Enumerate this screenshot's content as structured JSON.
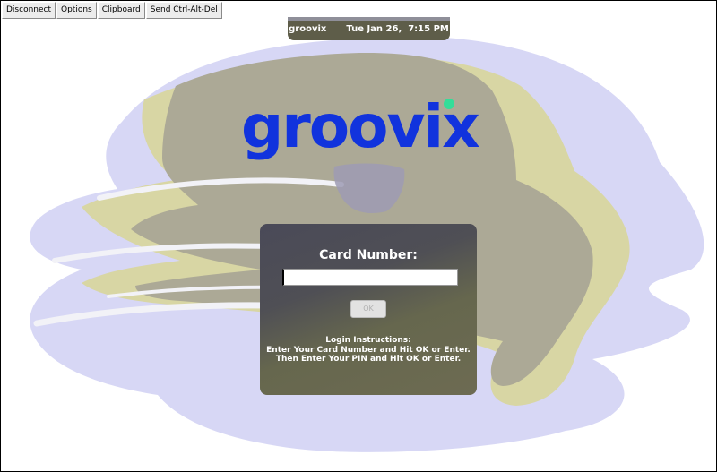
{
  "toolbar": {
    "items": [
      {
        "label": "Disconnect"
      },
      {
        "label": "Options"
      },
      {
        "label": "Clipboard"
      },
      {
        "label": "Send Ctrl-Alt-Del"
      }
    ]
  },
  "clock_bar": {
    "name": "groovix",
    "datetime": "Tue Jan 26,  7:15 PM"
  },
  "logo": {
    "text": "groovix",
    "color": "#1133dd",
    "dot_color": "#33dd99"
  },
  "login": {
    "label": "Card Number:",
    "card_value": "",
    "ok_label": "OK",
    "instructions_title": "Login Instructions:",
    "instructions_line1": "Enter Your Card Number and Hit OK or Enter.",
    "instructions_line2": "Then Enter Your PIN and Hit OK or Enter."
  },
  "colors": {
    "background_blob": "#d8d8f4",
    "yellow_stroke": "#d8d6a4",
    "gray_shape": "#adaa96",
    "panel": "#5a5a52"
  }
}
